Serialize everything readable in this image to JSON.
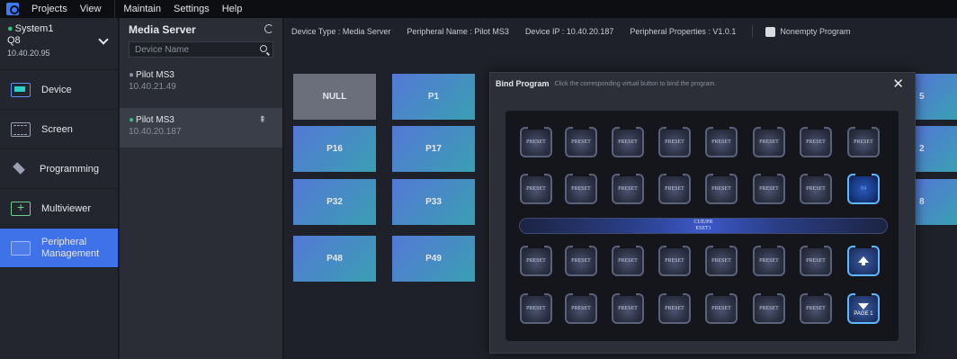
{
  "menu": {
    "items": [
      "Projects",
      "View",
      "Maintain",
      "Settings",
      "Help"
    ]
  },
  "system": {
    "name": "System1",
    "model": "Q8",
    "ip": "10.40.20.95"
  },
  "nav": {
    "items": [
      "Device",
      "Screen",
      "Programming",
      "Multiviewer",
      "Peripheral Management"
    ]
  },
  "media": {
    "title": "Media Server",
    "search_placeholder": "Device Name",
    "devices": [
      {
        "name": "Pilot MS3",
        "ip": "10.40.21.49"
      },
      {
        "name": "Pilot MS3",
        "ip": "10.40.20.187"
      }
    ]
  },
  "info": {
    "device_type": "Device Type : Media Server",
    "peripheral_name": "Peripheral Name : Pilot MS3",
    "device_ip": "Device IP : 10.40.20.187",
    "properties": "Peripheral Properties : V1.0.1",
    "nonempty": "Nonempty Program"
  },
  "programs": [
    "NULL",
    "P1",
    "P16",
    "P17",
    "P32",
    "P33",
    "P48",
    "P49"
  ],
  "programs_partial": [
    "5",
    "2",
    "8"
  ],
  "modal": {
    "title": "Bind Program",
    "subtitle": "Click the corresponding virtual button to bind the program.",
    "preset_label": "PRESET",
    "selected_label": "P4",
    "cue_line1": "CUE/PR",
    "cue_line2": "ESET1",
    "page_label": "PAGE 1"
  },
  "colors": {
    "accent": "#3f71e8",
    "online": "#2fbf71"
  },
  "icons": [
    "logo",
    "chevron-down-icon",
    "device-icon",
    "screen-icon",
    "programming-icon",
    "multiviewer-icon",
    "peripheral-icon",
    "refresh-icon",
    "search-icon",
    "pin-icon",
    "close-icon",
    "arrow-up-icon",
    "arrow-down-icon"
  ]
}
